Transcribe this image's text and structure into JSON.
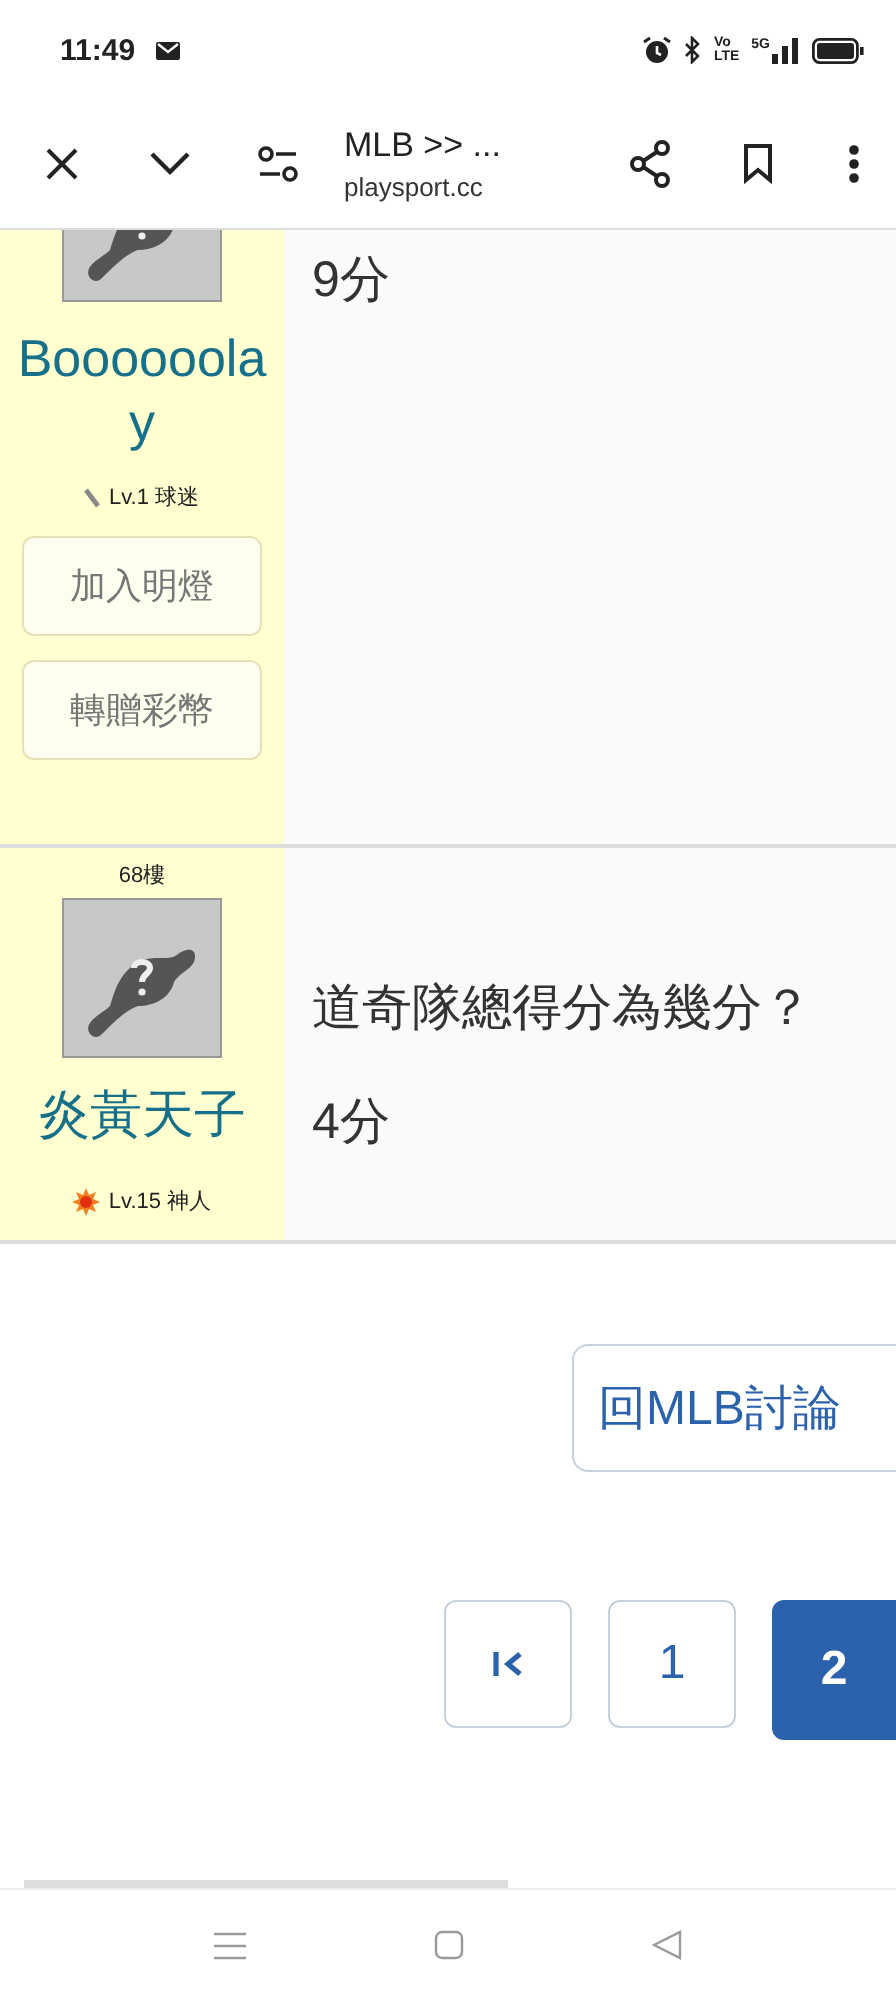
{
  "status_bar": {
    "time": "11:49",
    "volte": [
      "Vo",
      "LTE"
    ],
    "network": "5G"
  },
  "browser_toolbar": {
    "title": "MLB >> ...",
    "url": "playsport.cc"
  },
  "posts": [
    {
      "cut_top": true,
      "username": [
        "Boooooola",
        "y"
      ],
      "kind": "pen",
      "level": "Lv.1 球迷",
      "buttons": [
        "加入明燈",
        "轉贈彩幣"
      ],
      "lines": [
        "9分"
      ]
    },
    {
      "floor": "68樓",
      "cut_top": false,
      "username": [
        "炎黃天子"
      ],
      "kind": "sun",
      "level": "Lv.15 神人",
      "lines": [
        "道奇隊總得分為幾分？",
        "4分"
      ]
    }
  ],
  "back_button": "回MLB討論",
  "pagination": [
    {
      "label": "1",
      "selected": false
    },
    {
      "label": "2",
      "selected": true
    }
  ]
}
